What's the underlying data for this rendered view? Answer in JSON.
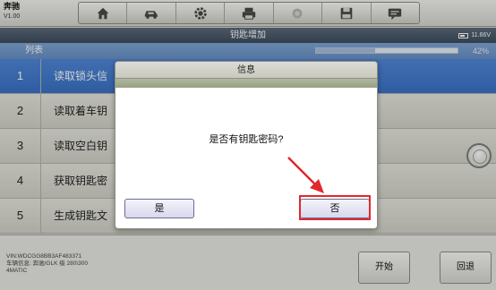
{
  "app": {
    "name": "奔驰",
    "version": "V1.00"
  },
  "toolbar": {
    "icons": [
      "home-icon",
      "car-tool-icon",
      "gear-icon",
      "printer-icon",
      "camera-icon",
      "save-icon",
      "message-icon"
    ]
  },
  "header": {
    "title": "钥匙增加",
    "battery": "11.66V"
  },
  "list": {
    "header_label": "列表",
    "progress_text": "42%",
    "progress_fraction": 0.42,
    "rows": [
      {
        "num": "1",
        "text": "读取锁头信",
        "selected": true
      },
      {
        "num": "2",
        "text": "读取着车钥",
        "selected": false
      },
      {
        "num": "3",
        "text": "读取空白钥",
        "selected": false
      },
      {
        "num": "4",
        "text": "获取钥匙密",
        "selected": false
      },
      {
        "num": "5",
        "text": "生成钥匙文",
        "selected": false
      }
    ]
  },
  "dialog": {
    "title": "信息",
    "message": "是否有钥匙密码?",
    "yes_label": "是",
    "no_label": "否"
  },
  "footer": {
    "vin": "VIN:WDCGG8BB3AF483371",
    "vehicle_line1": "车辆信息: 奔驰/GLK 级 280\\300",
    "vehicle_line2": "4MATIC",
    "start_label": "开始",
    "back_label": "回退"
  },
  "colors": {
    "accent_blue": "#3b72c6",
    "highlight_red": "#e0282e"
  }
}
